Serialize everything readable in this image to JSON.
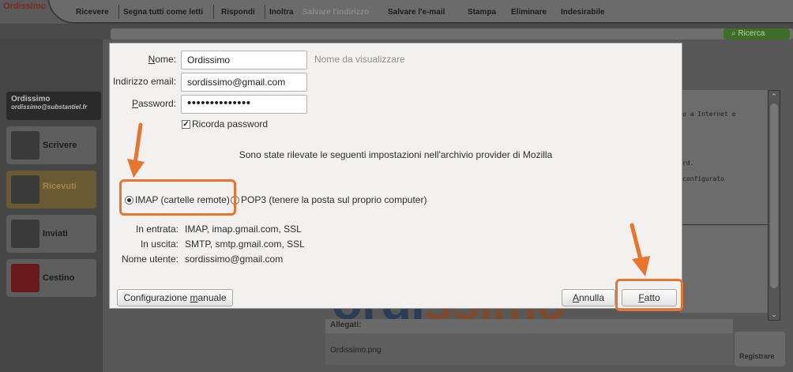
{
  "toolbar": {
    "logo_stub": "Ordissimo",
    "items": [
      "Ricevere",
      "Segna tutti come letti",
      "Rispondi",
      "Inoltra",
      "Salvare l'indirizzo",
      "Salvare l'e-mail",
      "Stampa",
      "Eliminare",
      "Indesirabile"
    ],
    "disabled": [
      "Salvare l'indirizzo"
    ],
    "search_label": "Ricerca"
  },
  "account": {
    "name": "Ordissimo",
    "email": "ordissimo@substantiel.fr"
  },
  "folders": [
    {
      "label": "Scrivere"
    },
    {
      "label": "Ricevuti"
    },
    {
      "label": "Inviati"
    },
    {
      "label": "Cestino"
    }
  ],
  "message_preview": {
    "lines": [
      "o a Internet e",
      "rd.",
      "configurato"
    ]
  },
  "background_logo": {
    "part1": "ordi",
    "part2": "ssimo"
  },
  "attachments": {
    "label": "Allegati:",
    "file": "Ordissimo.png",
    "save_button": "Registrare"
  },
  "dialog": {
    "name_label": "Nome:",
    "name_value": "Ordissimo",
    "name_hint": "Nome da visualizzare",
    "email_label": "Indirizzo email:",
    "email_value": "sordissimo@gmail.com",
    "password_label": "Password:",
    "password_value": "••••••••••••••",
    "remember_label": "Ricorda password",
    "remember_checked": true,
    "detected_info": "Sono state rilevate le seguenti impostazioni nell'archivio provider di Mozilla",
    "radio_imap": "IMAP (cartelle remote)",
    "radio_pop3": "POP3 (tenere la posta sul proprio computer)",
    "selected_protocol": "IMAP",
    "incoming_label": "In entrata:",
    "incoming_value": "IMAP, imap.gmail.com, SSL",
    "outgoing_label": "In uscita:",
    "outgoing_value": "SMTP, smtp.gmail.com, SSL",
    "username_label": "Nome utente:",
    "username_value": "sordissimo@gmail.com",
    "manual_config_button": "Configurazione manuale",
    "cancel_button": "Annulla",
    "done_button": "Fatto"
  },
  "annotation": {
    "color": "#e8752b"
  }
}
